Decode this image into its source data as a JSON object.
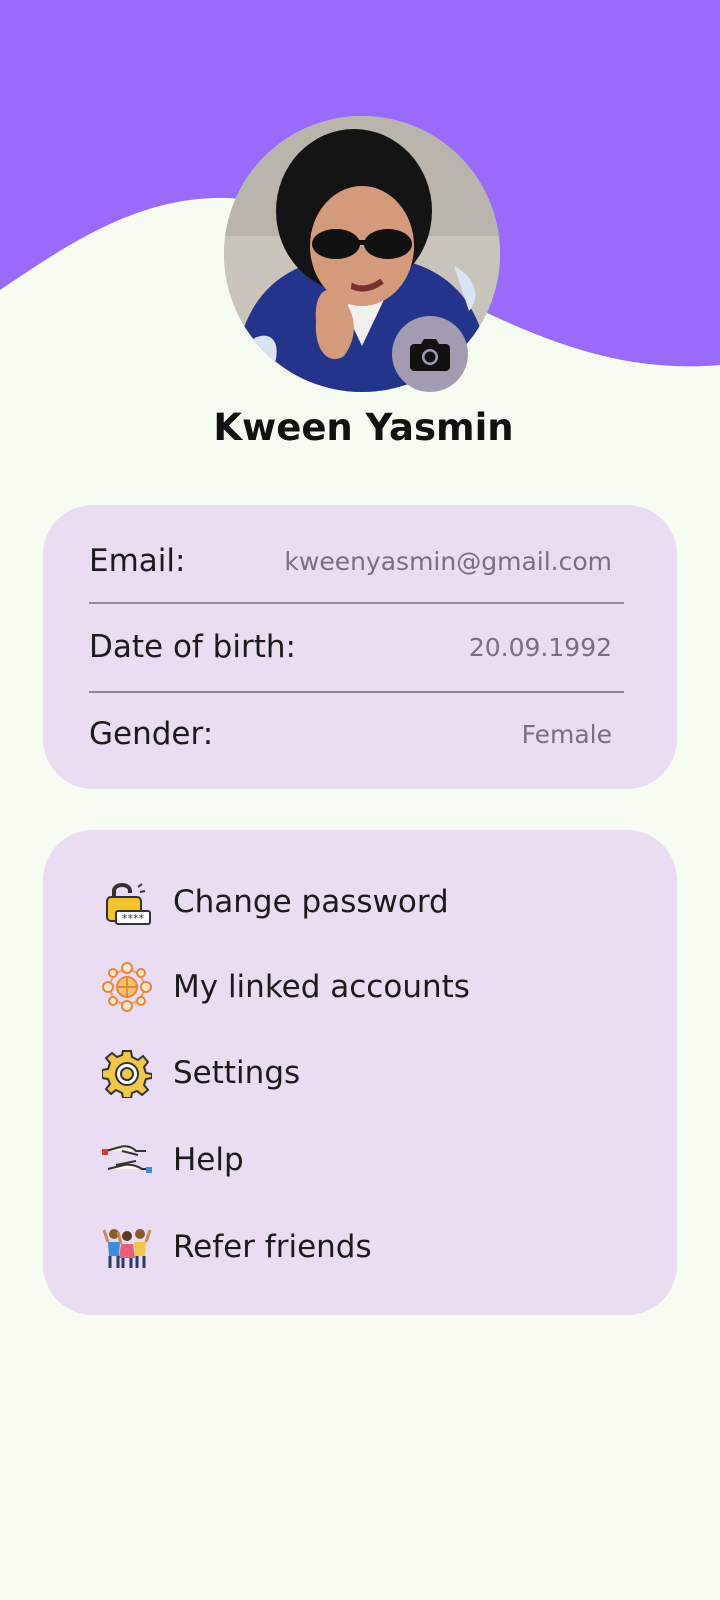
{
  "profile": {
    "name": "Kween Yasmin"
  },
  "info": {
    "email_label": "Email:",
    "email_value": "kweenyasmin@gmail.com",
    "dob_label": "Date of birth:",
    "dob_value": "20.09.1992",
    "gender_label": "Gender:",
    "gender_value": "Female"
  },
  "menu": {
    "items": [
      {
        "label": "Change password",
        "icon": "lock-password-icon"
      },
      {
        "label": "My linked accounts",
        "icon": "linked-network-icon"
      },
      {
        "label": "Settings",
        "icon": "gear-icon"
      },
      {
        "label": "Help",
        "icon": "helping-hands-icon"
      },
      {
        "label": "Refer friends",
        "icon": "friends-group-icon"
      }
    ]
  },
  "colors": {
    "header_purple": "#9a6bfb",
    "background": "#f7fcf2",
    "card": "#e9dcf3",
    "camera_button": "#a29bb2"
  }
}
